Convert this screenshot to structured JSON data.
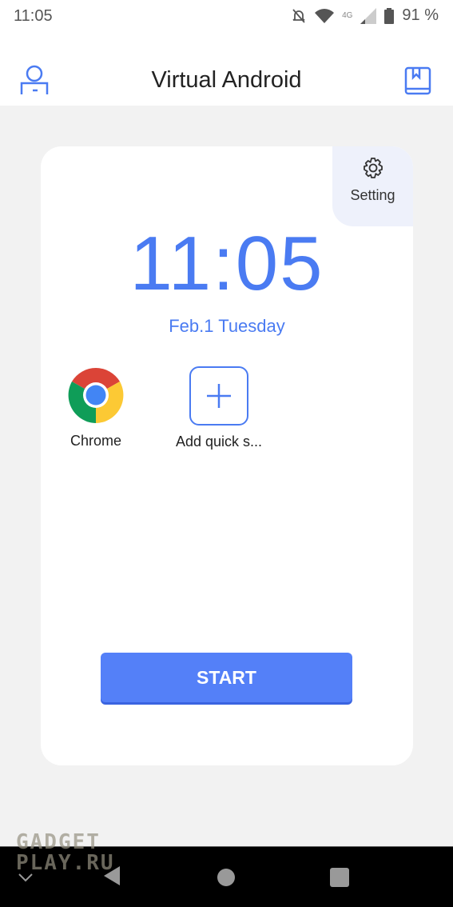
{
  "status_bar": {
    "time": "11:05",
    "battery": "91 %",
    "network": "4G",
    "icons": [
      "bell-off-icon",
      "wifi-icon",
      "signal-icon",
      "battery-icon"
    ]
  },
  "header": {
    "title": "Virtual Android",
    "left_icon": "user-icon",
    "right_icon": "book-icon"
  },
  "card": {
    "setting_label": "Setting",
    "clock": "11:05",
    "date": "Feb.1 Tuesday",
    "apps": [
      {
        "label": "Chrome",
        "icon": "chrome-icon"
      },
      {
        "label": "Add quick s...",
        "icon": "plus-icon"
      }
    ],
    "start_label": "START"
  },
  "watermark": "GADGET PLAY.RU",
  "colors": {
    "accent": "#4a7bf2",
    "button": "#5480f8"
  }
}
